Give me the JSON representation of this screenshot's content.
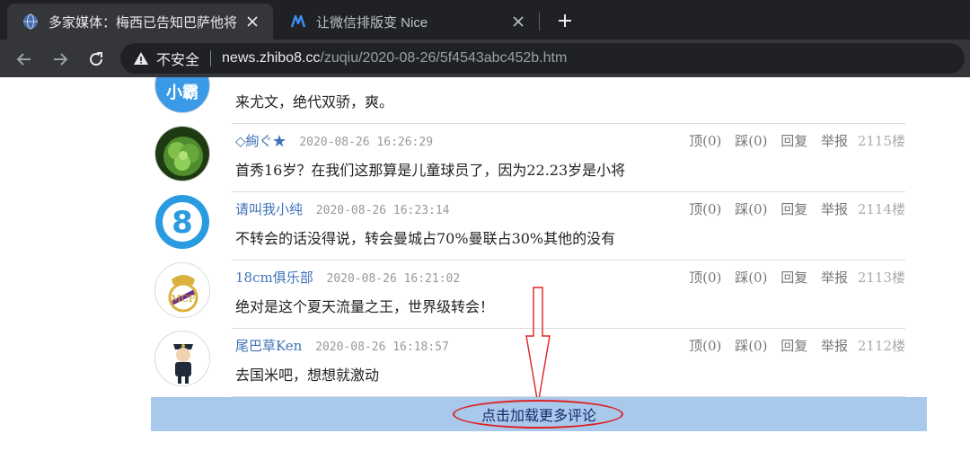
{
  "browser": {
    "tabs": [
      {
        "title": "多家媒体：梅西已告知巴萨他将离开",
        "favicon": "globe-icon",
        "active": true
      },
      {
        "title": "让微信排版变 Nice",
        "favicon": "nice-logo-icon",
        "active": false
      }
    ],
    "address": {
      "security_label": "不安全",
      "host": "news.zhibo8.cc",
      "path": "/zuqiu/2020-08-26/5f4543abc452b.htm"
    }
  },
  "actions": {
    "up": "顶(0)",
    "down": "踩(0)",
    "reply": "回复",
    "report": "举报"
  },
  "comments": [
    {
      "avatar": "xiaoba-avatar",
      "avatar_text": "小霸",
      "nick": "",
      "time": "",
      "floor": "",
      "text": "来尤文，绝代双骄，爽。"
    },
    {
      "avatar": "lettuce-avatar",
      "nick": "◇絢ぐ★",
      "time": "2020-08-26 16:26:29",
      "floor": "2115楼",
      "text": "首秀16岁？在我们这那算是儿童球员了，因为22.23岁是小将"
    },
    {
      "avatar": "number-eight-avatar",
      "avatar_text": "8",
      "nick": "请叫我小纯",
      "time": "2020-08-26 16:23:14",
      "floor": "2114楼",
      "text": "不转会的话没得说，转会曼城占70%曼联占30%其他的没有"
    },
    {
      "avatar": "real-madrid-crest-avatar",
      "nick": "18cm俱乐部",
      "time": "2020-08-26 16:21:02",
      "floor": "2113楼",
      "text": "绝对是这个夏天流量之王，世界级转会！"
    },
    {
      "avatar": "police-cartoon-avatar",
      "nick": "尾巴草Ken",
      "time": "2020-08-26 16:18:57",
      "floor": "2112楼",
      "text": "去国米吧，想想就激动"
    }
  ],
  "load_more": {
    "label": "点击加载更多评论"
  },
  "colors": {
    "link": "#3f73b8",
    "load_more_bg": "#a8c8ec",
    "annotation": "#d22222"
  }
}
